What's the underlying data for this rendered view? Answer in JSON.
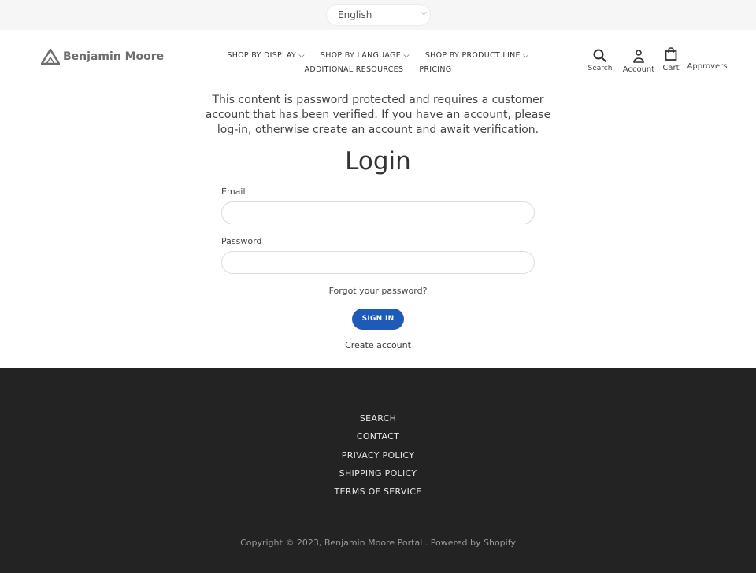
{
  "language_selector": {
    "value": "English"
  },
  "logo": {
    "text": "Benjamin Moore"
  },
  "nav": {
    "items": [
      {
        "label": "SHOP BY DISPLAY",
        "dropdown": true
      },
      {
        "label": "SHOP BY LANGUAGE",
        "dropdown": true
      },
      {
        "label": "SHOP BY PRODUCT LINE",
        "dropdown": true
      },
      {
        "label": "ADDITIONAL RESOURCES",
        "dropdown": false
      },
      {
        "label": "PRICING",
        "dropdown": false
      }
    ]
  },
  "header_icons": {
    "search": "Search",
    "account": "Account",
    "cart": "Cart",
    "approvers": "Approvers"
  },
  "main": {
    "message": "This content is password protected and requires a customer account that has been verified. If you have an account, please log-in, otherwise create an account and await verification.",
    "title": "Login",
    "email_label": "Email",
    "email_value": "",
    "password_label": "Password",
    "password_value": "",
    "forgot": "Forgot your password?",
    "sign_in": "SIGN IN",
    "create": "Create account",
    "accent": "#1e5bb8"
  },
  "footer": {
    "links": [
      "SEARCH",
      "CONTACT",
      "PRIVACY POLICY",
      "SHIPPING POLICY",
      "TERMS OF SERVICE"
    ],
    "copyright": "Copyright © 2023, Benjamin Moore Portal . Powered by Shopify"
  }
}
